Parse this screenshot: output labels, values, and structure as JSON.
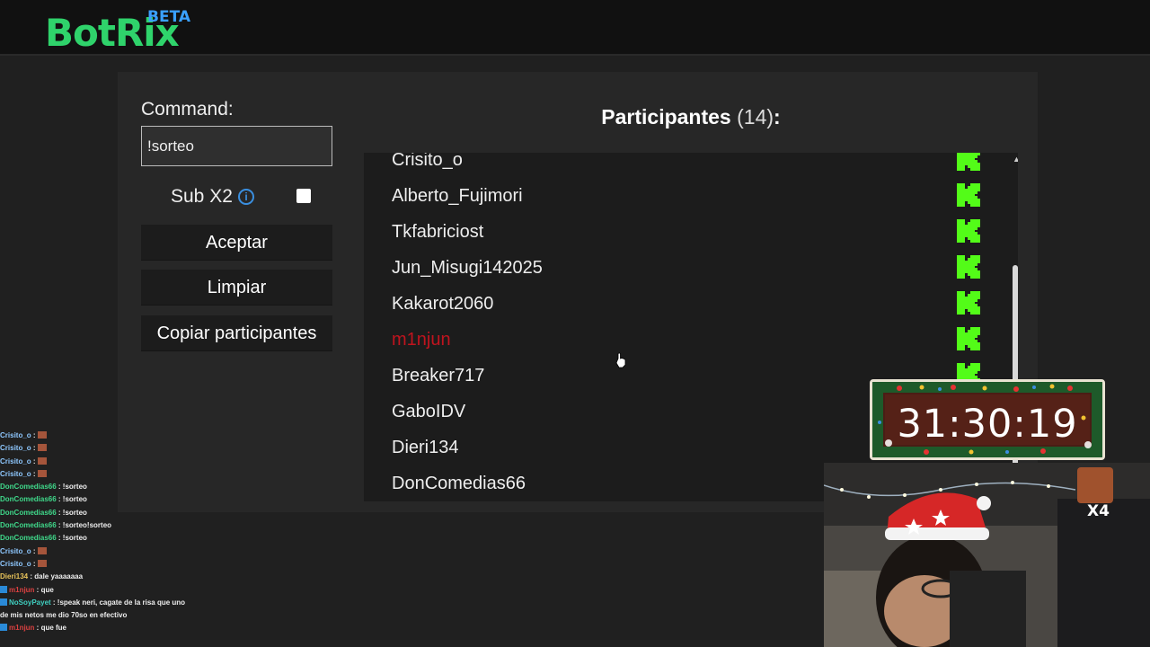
{
  "header": {
    "logo": "BotRix",
    "badge": "BETA"
  },
  "form": {
    "command_label": "Command:",
    "command_value": "!sorteo",
    "sub_label": "Sub X2",
    "sub_checked": false,
    "accept_label": "Aceptar",
    "clear_label": "Limpiar",
    "copy_label": "Copiar participantes"
  },
  "participants": {
    "title": "Participantes",
    "count": "(14)",
    "colon": ":",
    "items": [
      {
        "name": "Crisito_o",
        "color": "#eeeeee"
      },
      {
        "name": "Alberto_Fujimori",
        "color": "#eeeeee"
      },
      {
        "name": "Tkfabriciost",
        "color": "#eeeeee"
      },
      {
        "name": "Jun_Misugi142025",
        "color": "#eeeeee"
      },
      {
        "name": "Kakarot2060",
        "color": "#eeeeee"
      },
      {
        "name": "m1njun",
        "color": "#c0141e"
      },
      {
        "name": "Breaker717",
        "color": "#eeeeee"
      },
      {
        "name": "GaboIDV",
        "color": "#eeeeee"
      },
      {
        "name": "Dieri134",
        "color": "#eeeeee"
      },
      {
        "name": "DonComedias66",
        "color": "#eeeeee"
      }
    ]
  },
  "timer": {
    "value": "31:30:19"
  },
  "webcam": {
    "multiplier": "x4"
  },
  "chat": [
    {
      "user": "Crisito_o",
      "text": "",
      "kind": "blue",
      "emote": true
    },
    {
      "user": "Crisito_o",
      "text": "",
      "kind": "blue",
      "emote": true
    },
    {
      "user": "Crisito_o",
      "text": "",
      "kind": "blue",
      "emote": true
    },
    {
      "user": "Crisito_o",
      "text": "",
      "kind": "blue",
      "emote": true
    },
    {
      "user": "DonComedias66",
      "text": "!sorteo",
      "kind": "green"
    },
    {
      "user": "DonComedias66",
      "text": "!sorteo",
      "kind": "green"
    },
    {
      "user": "DonComedias66",
      "text": "!sorteo",
      "kind": "green"
    },
    {
      "user": "DonComedias66",
      "text": "!sorteo!sorteo",
      "kind": "green"
    },
    {
      "user": "DonComedias66",
      "text": "!sorteo",
      "kind": "green"
    },
    {
      "user": "Crisito_o",
      "text": "",
      "kind": "blue",
      "emote": true
    },
    {
      "user": "Crisito_o",
      "text": "",
      "kind": "blue",
      "emote": true
    },
    {
      "user": "Dieri134",
      "text": "dale yaaaaaaa",
      "kind": "gold"
    },
    {
      "user": "m1njun",
      "text": "que",
      "kind": "red",
      "badge": true
    },
    {
      "user": "NoSoyPayet",
      "text": "!speak neri, cagate de la risa que uno",
      "kind": "teal",
      "badge": true
    },
    {
      "user": "",
      "text": "de mis netos me dio 70so en efectivo",
      "kind": "none"
    },
    {
      "user": "m1njun",
      "text": "que fue",
      "kind": "red",
      "badge": true
    }
  ]
}
